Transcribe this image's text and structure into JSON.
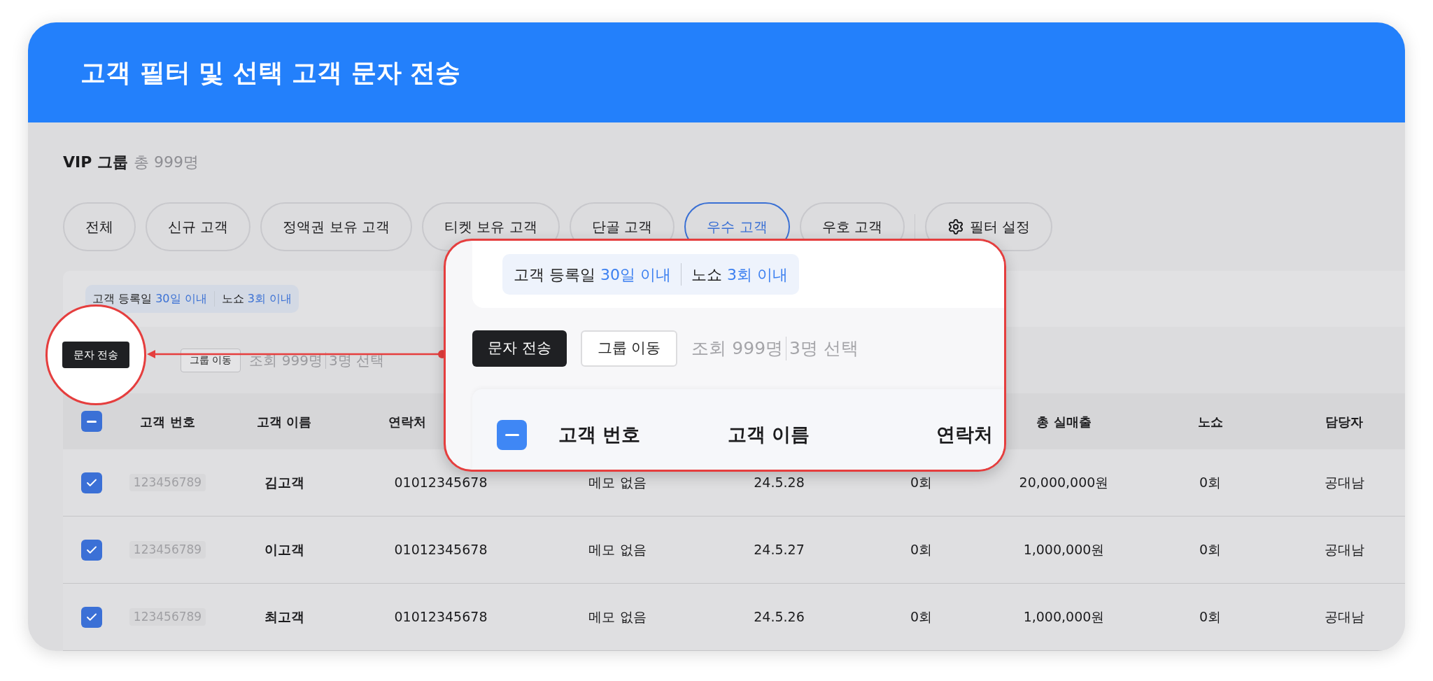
{
  "title": "고객 필터 및 선택 고객 문자 전송",
  "group": {
    "name": "VIP 그룹",
    "total": "총 999명"
  },
  "filter_chips": [
    {
      "label": "전체",
      "selected": false
    },
    {
      "label": "신규 고객",
      "selected": false
    },
    {
      "label": "정액권 보유 고객",
      "selected": false
    },
    {
      "label": "티켓 보유 고객",
      "selected": false
    },
    {
      "label": "단골 고객",
      "selected": false
    },
    {
      "label": "우수 고객",
      "selected": true
    },
    {
      "label": "우호 고객",
      "selected": false
    }
  ],
  "filter_settings": "필터 설정",
  "active_filters": [
    {
      "label": "고객 등록일",
      "value": "30일 이내"
    },
    {
      "label": "노쇼",
      "value": "3회 이내"
    }
  ],
  "actions": {
    "move_button": "그룹 이동",
    "count": "조회 999명",
    "selected_count": "3명 선택"
  },
  "magnifier": {
    "button": "문자 전송"
  },
  "table": {
    "select_all": {
      "indeterminate": true
    },
    "columns": [
      {
        "label": "고객 번호"
      },
      {
        "label": "고객 이름"
      },
      {
        "label": "연락처"
      },
      {},
      {},
      {},
      {
        "label": "총 실매출"
      },
      {
        "label": "노쇼"
      },
      {
        "label": "담당자"
      }
    ],
    "rows": [
      {
        "selected": true,
        "cells": [
          "123456789",
          "김고객",
          "01012345678",
          "메모 없음",
          "24.5.28",
          "0회",
          "20,000,000원",
          "0회",
          "공대남"
        ]
      },
      {
        "selected": true,
        "cells": [
          "123456789",
          "이고객",
          "01012345678",
          "메모 없음",
          "24.5.27",
          "0회",
          "1,000,000원",
          "0회",
          "공대남"
        ]
      },
      {
        "selected": true,
        "cells": [
          "123456789",
          "최고객",
          "01012345678",
          "메모 없음",
          "24.5.26",
          "0회",
          "1,000,000원",
          "0회",
          "공대남"
        ]
      }
    ]
  },
  "callout": {
    "active_filters": [
      {
        "label": "고객 등록일",
        "value": "30일 이내"
      },
      {
        "label": "노쇼",
        "value": "3회 이내"
      }
    ],
    "send_button": "문자 전송",
    "move_button": "그룹 이동",
    "count": "조회 999명",
    "selected_count": "3명 선택",
    "select_all": {
      "indeterminate": true
    },
    "columns": [
      "고객 번호",
      "고객 이름",
      "연락처"
    ]
  }
}
